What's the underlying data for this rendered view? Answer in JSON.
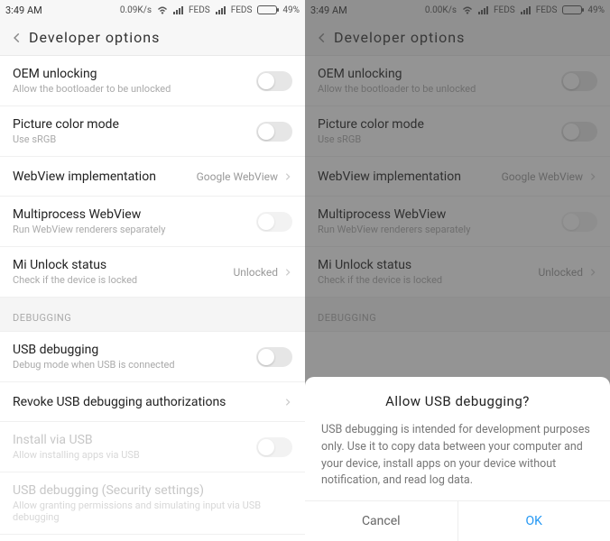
{
  "status": {
    "time": "3:49 AM",
    "speed_left": "0.09K/s",
    "speed_right": "0.00K/s",
    "carrier1": "FEDS",
    "carrier2": "FEDS",
    "battery_pct": "49%"
  },
  "header": {
    "title": "Developer  options"
  },
  "items": {
    "oem_title": "OEM unlocking",
    "oem_sub": "Allow the bootloader to be unlocked",
    "pcm_title": "Picture color mode",
    "pcm_sub": "Use sRGB",
    "webview_title": "WebView implementation",
    "webview_value": "Google WebView",
    "mpwv_title": "Multiprocess WebView",
    "mpwv_sub": "Run WebView renderers separately",
    "miunlock_title": "Mi Unlock status",
    "miunlock_sub": "Check if the device is locked",
    "miunlock_value": "Unlocked",
    "section_debug": "DEBUGGING",
    "usbdbg_title": "USB debugging",
    "usbdbg_sub": "Debug mode when USB is connected",
    "revoke_title": "Revoke USB debugging authorizations",
    "install_usb_title": "Install via USB",
    "install_usb_sub": "Allow installing apps via USB",
    "usbsec_title": "USB debugging (Security settings)",
    "usbsec_sub": "Allow granting permissions and simulating input via USB debugging"
  },
  "dialog": {
    "title": "Allow  USB  debugging?",
    "body": "USB debugging is intended for development purposes only. Use it to copy data between your computer and your device, install apps on your device without notification, and read log data.",
    "cancel": "Cancel",
    "ok": "OK"
  }
}
